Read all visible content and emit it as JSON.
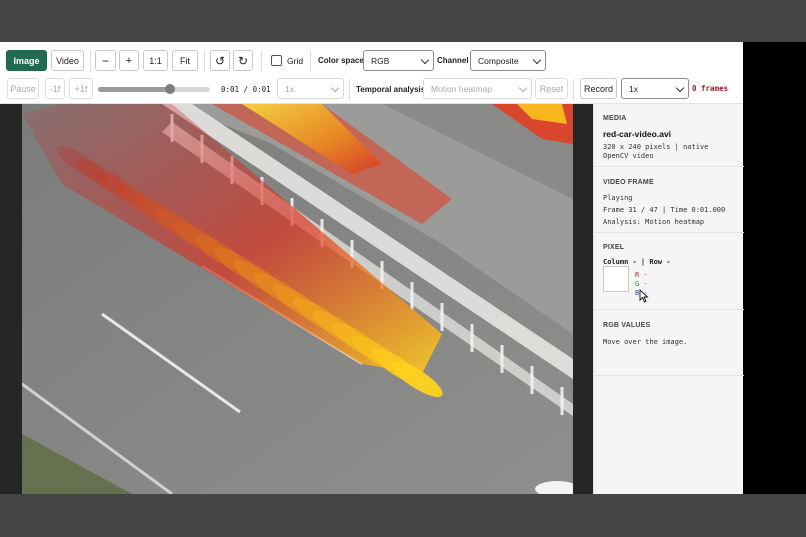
{
  "toolbar": {
    "image_label": "Image",
    "video_label": "Video",
    "zoom_out": "−",
    "zoom_in": "+",
    "actual_size": "1:1",
    "fit": "Fit",
    "rotate_left": "↺",
    "rotate_right": "↻",
    "grid_label": "Grid",
    "colorspace_label": "Color space",
    "colorspace_value": "RGB",
    "channel_label": "Channel",
    "channel_value": "Composite"
  },
  "playback": {
    "pause": "Pause",
    "prev_frame": "-1f",
    "next_frame": "+1f",
    "time": "0:01 / 0:01",
    "progress": 0.64,
    "speed": "1x",
    "temporal_label": "Temporal analysis",
    "temporal_value": "Motion heatmap",
    "reset": "Reset",
    "record": "Record",
    "record_speed": "1x",
    "frames": "0 frames"
  },
  "panel": {
    "media": {
      "title": "MEDIA",
      "filename": "red-car-video.avi",
      "dims": "320 x 240 pixels | native",
      "source": "OpenCV video"
    },
    "frame": {
      "title": "VIDEO FRAME",
      "state": "Playing",
      "frame_info": "Frame 31 / 47 | Time 0:01.000",
      "analysis": "Analysis: Motion heatmap"
    },
    "pixel": {
      "title": "PIXEL",
      "coords": "Column - | Row -",
      "r": "R -",
      "g": "G -",
      "b": "B -"
    },
    "rgb": {
      "title": "RGB VALUES",
      "hint": "Move over the image."
    }
  },
  "colors": {
    "accent": "#1e6b50",
    "frames_text": "#9b1b1b"
  }
}
